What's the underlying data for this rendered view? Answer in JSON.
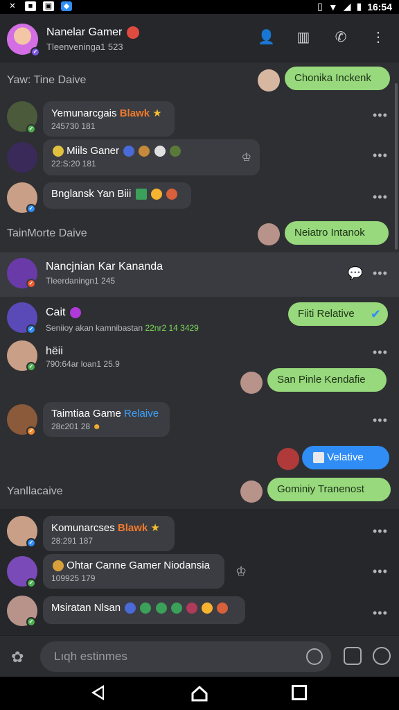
{
  "status_bar": {
    "time": "16:54"
  },
  "header": {
    "title": "Nanelar Gamer",
    "subtitle": "Tleenveninga1 523",
    "icons": [
      "add-contact-icon",
      "bookmark-icon",
      "call-icon",
      "more-icon"
    ]
  },
  "sections": {
    "s1": "Yaw: Tine Daive",
    "s2": "TainMorte Daive",
    "s3": "Yanllacaive"
  },
  "bubbles_out": {
    "b1": "Chonika Inckenk",
    "b2": "Neiatro Intanok",
    "b3": "Fiiti Relative",
    "b4": "San Pinle Kendafie",
    "b5": "Velative",
    "b6": "Gominiy Tranenost"
  },
  "rows": {
    "r1": {
      "name": "Yemunarcgais",
      "tag": "Blawk",
      "meta": "245730 181"
    },
    "r2": {
      "name": "Miils Ganer",
      "meta": "22:S:20 181"
    },
    "r3": {
      "name": "Bnglansk Yan Biii"
    },
    "r4": {
      "name": "Nancjnian Kar Kananda",
      "meta": "Tleerdaningn1 245"
    },
    "r5": {
      "name": "Cait",
      "meta": "Seniioy akan kamnibastan",
      "meta_green": "22nr2 14 3429"
    },
    "r6": {
      "name": "hëii",
      "meta": "790:64ar loan1 25.9"
    },
    "r7": {
      "name": "Taimtiaa Game",
      "tag": "Relaive",
      "meta": "28c201 28"
    },
    "r8": {
      "name": "Komunarcses",
      "tag": "Blawk",
      "meta": "28:291 187"
    },
    "r9": {
      "name": "Ohtar Canne Gamer Niodansia",
      "meta": "109925 179"
    },
    "r10": {
      "name": "Msiratan Nlsan"
    }
  },
  "input": {
    "placeholder": "Lıqh estinmes"
  },
  "colors": {
    "accent_green": "#97d97c",
    "accent_blue": "#2f8df5",
    "background": "#2e2f33"
  }
}
